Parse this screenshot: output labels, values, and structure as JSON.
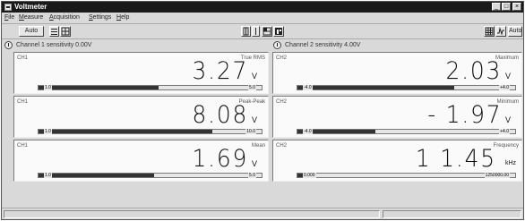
{
  "window": {
    "title": "Voltmeter",
    "minimize_glyph": "_",
    "maximize_glyph": "□",
    "close_glyph": "×"
  },
  "menu": {
    "items": [
      "File",
      "Measure",
      "Acquisition",
      "Settings",
      "Help"
    ]
  },
  "toolbar": {
    "auto_label": "Auto",
    "auto_label_right": "Auto",
    "icons": [
      "list-icon",
      "grid-icon",
      "single-column-icon",
      "half-column-icon",
      "three-panel-icon",
      "freeze-icon",
      "table-icon",
      "waveform-icon"
    ]
  },
  "channels": {
    "ch1_header": "Channel 1 sensitivity 0.00V",
    "ch2_header": "Channel 2 sensitivity 4.00V"
  },
  "panels": [
    {
      "channel": "CH1",
      "mode": "True RMS",
      "value": "3.27",
      "unit": "V",
      "scale_left": "1.0",
      "scale_right": "5.0",
      "fill_fraction": 0.54,
      "right_fill": false
    },
    {
      "channel": "CH2",
      "mode": "Maximum",
      "value": "2.03",
      "unit": "V",
      "scale_left": "-4.0",
      "scale_right": "+4.0",
      "fill_fraction": 0.72,
      "right_fill": false
    },
    {
      "channel": "CH1",
      "mode": "Peak-Peak",
      "value": "8.08",
      "unit": "V",
      "scale_left": "1.0",
      "scale_right": "10.0",
      "fill_fraction": 0.78,
      "right_fill": false
    },
    {
      "channel": "CH2",
      "mode": "Minimum",
      "value": "- 1.97",
      "unit": "V",
      "scale_left": "-4.0",
      "scale_right": "+4.0",
      "fill_fraction": 0.36,
      "right_fill": true
    },
    {
      "channel": "CH1",
      "mode": "Mean",
      "value": "1.69",
      "unit": "V",
      "scale_left": "1.0",
      "scale_right": "5.0",
      "fill_fraction": 0.52,
      "right_fill": false
    },
    {
      "channel": "CH2",
      "mode": "Frequency",
      "value": "1 1.45",
      "unit": "kHz",
      "scale_left": "0.000",
      "scale_right": "1250000.00",
      "fill_fraction": 0.05,
      "right_fill": false
    }
  ]
}
